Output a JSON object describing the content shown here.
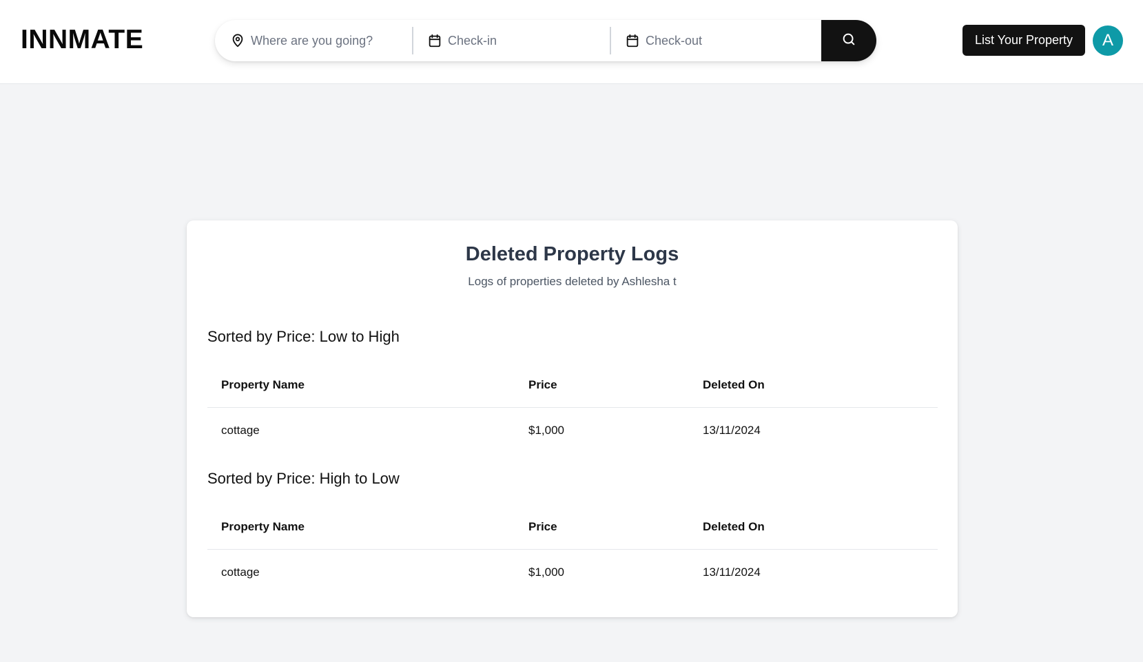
{
  "header": {
    "logo": "INNMATE",
    "search": {
      "where_placeholder": "Where are you going?",
      "checkin_placeholder": "Check-in",
      "checkout_placeholder": "Check-out",
      "search_icon": "search-icon"
    },
    "list_property_label": "List Your Property",
    "avatar_letter": "A"
  },
  "main": {
    "title": "Deleted Property Logs",
    "subtitle": "Logs of properties deleted by Ashlesha t",
    "sections": [
      {
        "title": "Sorted by Price: Low to High",
        "columns": [
          "Property Name",
          "Price",
          "Deleted On"
        ],
        "rows": [
          {
            "name": "cottage",
            "price": "$1,000",
            "deleted_on": "13/11/2024"
          }
        ]
      },
      {
        "title": "Sorted by Price: High to Low",
        "columns": [
          "Property Name",
          "Price",
          "Deleted On"
        ],
        "rows": [
          {
            "name": "cottage",
            "price": "$1,000",
            "deleted_on": "13/11/2024"
          }
        ]
      }
    ]
  },
  "colors": {
    "accent_dark": "#121212",
    "avatar_bg": "#0e9aa7",
    "page_bg": "#f3f4f6"
  }
}
